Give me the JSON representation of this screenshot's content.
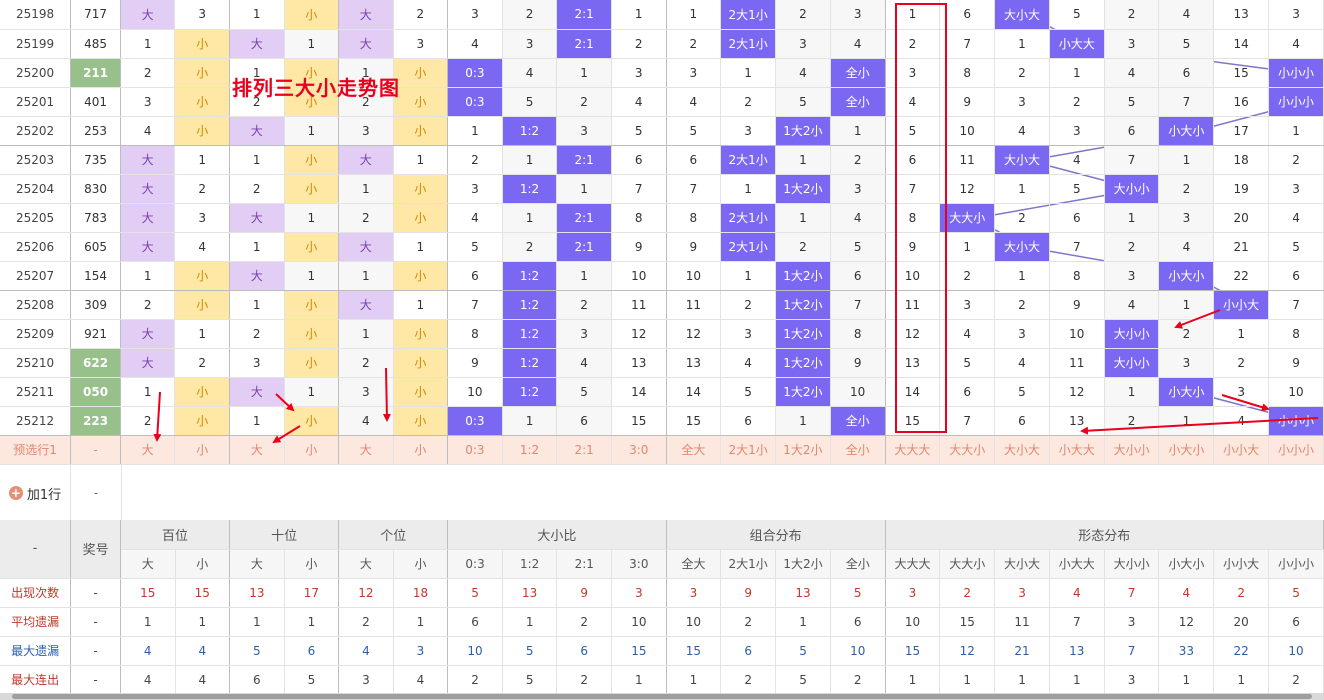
{
  "trend_rows": [
    {
      "issue": "25198",
      "award": "717",
      "hl": false,
      "bw": "大",
      "bx": "3",
      "sd": "1",
      "sx": "小",
      "gd": "大",
      "gx": "2",
      "r03": "3",
      "r12": "2",
      "r21": "2:1",
      "r30": "1",
      "qd": "1",
      "d2x1": "2大1小",
      "d1x2": "2",
      "qx": "3",
      "f1": "1",
      "f2": "6",
      "f3": "大小大",
      "f4": "5",
      "f5": "2",
      "f6": "4",
      "f7": "13",
      "f8": "3"
    },
    {
      "issue": "25199",
      "award": "485",
      "hl": false,
      "bw": "1",
      "bx": "小",
      "sd": "大",
      "sx": "1",
      "gd": "大",
      "gx": "3",
      "r03": "4",
      "r12": "3",
      "r21": "2:1",
      "r30": "2",
      "qd": "2",
      "d2x1": "2大1小",
      "d1x2": "3",
      "qx": "4",
      "f1": "2",
      "f2": "7",
      "f3": "1",
      "f4": "小大大",
      "f5": "3",
      "f6": "5",
      "f7": "14",
      "f8": "4"
    },
    {
      "issue": "25200",
      "award": "211",
      "hl": true,
      "bw": "2",
      "bx": "小",
      "sd": "1",
      "sx": "小",
      "gd": "1",
      "gx": "小",
      "r03": "0:3",
      "r12": "4",
      "r21": "1",
      "r30": "3",
      "qd": "3",
      "d2x1": "1",
      "d1x2": "4",
      "qx": "全小",
      "f1": "3",
      "f2": "8",
      "f3": "2",
      "f4": "1",
      "f5": "4",
      "f6": "6",
      "f7": "15",
      "f8": "小小小"
    },
    {
      "issue": "25201",
      "award": "401",
      "hl": false,
      "bw": "3",
      "bx": "小",
      "sd": "2",
      "sx": "小",
      "gd": "2",
      "gx": "小",
      "r03": "0:3",
      "r12": "5",
      "r21": "2",
      "r30": "4",
      "qd": "4",
      "d2x1": "2",
      "d1x2": "5",
      "qx": "全小",
      "f1": "4",
      "f2": "9",
      "f3": "3",
      "f4": "2",
      "f5": "5",
      "f6": "7",
      "f7": "16",
      "f8": "小小小"
    },
    {
      "issue": "25202",
      "award": "253",
      "hl": false,
      "bw": "4",
      "bx": "小",
      "sd": "大",
      "sx": "1",
      "gd": "3",
      "gx": "小",
      "r03": "1",
      "r12": "1:2",
      "r21": "3",
      "r30": "5",
      "qd": "5",
      "d2x1": "3",
      "d1x2": "1大2小",
      "qx": "1",
      "f1": "5",
      "f2": "10",
      "f3": "4",
      "f4": "3",
      "f5": "6",
      "f6": "小大小",
      "f7": "17",
      "f8": "1"
    },
    {
      "issue": "25203",
      "award": "735",
      "hl": false,
      "bw": "大",
      "bx": "1",
      "sd": "1",
      "sx": "小",
      "gd": "大",
      "gx": "1",
      "r03": "2",
      "r12": "1",
      "r21": "2:1",
      "r30": "6",
      "qd": "6",
      "d2x1": "2大1小",
      "d1x2": "1",
      "qx": "2",
      "f1": "6",
      "f2": "11",
      "f3": "大小大",
      "f4": "4",
      "f5": "7",
      "f6": "1",
      "f7": "18",
      "f8": "2"
    },
    {
      "issue": "25204",
      "award": "830",
      "hl": false,
      "bw": "大",
      "bx": "2",
      "sd": "2",
      "sx": "小",
      "gd": "1",
      "gx": "小",
      "r03": "3",
      "r12": "1:2",
      "r21": "1",
      "r30": "7",
      "qd": "7",
      "d2x1": "1",
      "d1x2": "1大2小",
      "qx": "3",
      "f1": "7",
      "f2": "12",
      "f3": "1",
      "f4": "5",
      "f5": "大小小",
      "f6": "2",
      "f7": "19",
      "f8": "3"
    },
    {
      "issue": "25205",
      "award": "783",
      "hl": false,
      "bw": "大",
      "bx": "3",
      "sd": "大",
      "sx": "1",
      "gd": "2",
      "gx": "小",
      "r03": "4",
      "r12": "1",
      "r21": "2:1",
      "r30": "8",
      "qd": "8",
      "d2x1": "2大1小",
      "d1x2": "1",
      "qx": "4",
      "f1": "8",
      "f2": "大大小",
      "f3": "2",
      "f4": "6",
      "f5": "1",
      "f6": "3",
      "f7": "20",
      "f8": "4"
    },
    {
      "issue": "25206",
      "award": "605",
      "hl": false,
      "bw": "大",
      "bx": "4",
      "sd": "1",
      "sx": "小",
      "gd": "大",
      "gx": "1",
      "r03": "5",
      "r12": "2",
      "r21": "2:1",
      "r30": "9",
      "qd": "9",
      "d2x1": "2大1小",
      "d1x2": "2",
      "qx": "5",
      "f1": "9",
      "f2": "1",
      "f3": "大小大",
      "f4": "7",
      "f5": "2",
      "f6": "4",
      "f7": "21",
      "f8": "5"
    },
    {
      "issue": "25207",
      "award": "154",
      "hl": false,
      "bw": "1",
      "bx": "小",
      "sd": "大",
      "sx": "1",
      "gd": "1",
      "gx": "小",
      "r03": "6",
      "r12": "1:2",
      "r21": "1",
      "r30": "10",
      "qd": "10",
      "d2x1": "1",
      "d1x2": "1大2小",
      "qx": "6",
      "f1": "10",
      "f2": "2",
      "f3": "1",
      "f4": "8",
      "f5": "3",
      "f6": "小大小",
      "f7": "22",
      "f8": "6"
    },
    {
      "issue": "25208",
      "award": "309",
      "hl": false,
      "bw": "2",
      "bx": "小",
      "sd": "1",
      "sx": "小",
      "gd": "大",
      "gx": "1",
      "r03": "7",
      "r12": "1:2",
      "r21": "2",
      "r30": "11",
      "qd": "11",
      "d2x1": "2",
      "d1x2": "1大2小",
      "qx": "7",
      "f1": "11",
      "f2": "3",
      "f3": "2",
      "f4": "9",
      "f5": "4",
      "f6": "1",
      "f7": "小小大",
      "f8": "7"
    },
    {
      "issue": "25209",
      "award": "921",
      "hl": false,
      "bw": "大",
      "bx": "1",
      "sd": "2",
      "sx": "小",
      "gd": "1",
      "gx": "小",
      "r03": "8",
      "r12": "1:2",
      "r21": "3",
      "r30": "12",
      "qd": "12",
      "d2x1": "3",
      "d1x2": "1大2小",
      "qx": "8",
      "f1": "12",
      "f2": "4",
      "f3": "3",
      "f4": "10",
      "f5": "大小小",
      "f6": "2",
      "f7": "1",
      "f8": "8"
    },
    {
      "issue": "25210",
      "award": "622",
      "hl": true,
      "bw": "大",
      "bx": "2",
      "sd": "3",
      "sx": "小",
      "gd": "2",
      "gx": "小",
      "r03": "9",
      "r12": "1:2",
      "r21": "4",
      "r30": "13",
      "qd": "13",
      "d2x1": "4",
      "d1x2": "1大2小",
      "qx": "9",
      "f1": "13",
      "f2": "5",
      "f3": "4",
      "f4": "11",
      "f5": "大小小",
      "f6": "3",
      "f7": "2",
      "f8": "9"
    },
    {
      "issue": "25211",
      "award": "050",
      "hl": true,
      "bw": "1",
      "bx": "小",
      "sd": "大",
      "sx": "1",
      "gd": "3",
      "gx": "小",
      "r03": "10",
      "r12": "1:2",
      "r21": "5",
      "r30": "14",
      "qd": "14",
      "d2x1": "5",
      "d1x2": "1大2小",
      "qx": "10",
      "f1": "14",
      "f2": "6",
      "f3": "5",
      "f4": "12",
      "f5": "1",
      "f6": "小大小",
      "f7": "3",
      "f8": "10"
    },
    {
      "issue": "25212",
      "award": "223",
      "hl": true,
      "bw": "2",
      "bx": "小",
      "sd": "1",
      "sx": "小",
      "gd": "4",
      "gx": "小",
      "r03": "0:3",
      "r12": "1",
      "r21": "6",
      "r30": "15",
      "qd": "15",
      "d2x1": "6",
      "d1x2": "1",
      "qx": "全小",
      "f1": "15",
      "f2": "7",
      "f3": "6",
      "f4": "13",
      "f5": "2",
      "f6": "1",
      "f7": "4",
      "f8": "小小小"
    }
  ],
  "preselect": {
    "label": "预选行1",
    "award": "-",
    "cells": [
      "大",
      "小",
      "大",
      "小",
      "大",
      "小",
      "0:3",
      "1:2",
      "2:1",
      "3:0",
      "全大",
      "2大1小",
      "1大2小",
      "全小",
      "大大大",
      "大大小",
      "大小大",
      "小大大",
      "大小小",
      "小大小",
      "小小大",
      "小小小"
    ]
  },
  "addrow": {
    "label": "加1行",
    "dash": "-"
  },
  "title_banner": "排列三大小走势图",
  "header": {
    "corner": "-",
    "award": "奖号",
    "groups": [
      "百位",
      "十位",
      "个位",
      "大小比",
      "组合分布",
      "形态分布"
    ],
    "sub": [
      "大",
      "小",
      "大",
      "小",
      "大",
      "小",
      "0:3",
      "1:2",
      "2:1",
      "3:0",
      "全大",
      "2大1小",
      "1大2小",
      "全小",
      "大大大",
      "大大小",
      "大小大",
      "小大大",
      "大小小",
      "小大小",
      "小小大",
      "小小小"
    ]
  },
  "stats": [
    {
      "label": "出现次数",
      "award": "-",
      "color": "red",
      "vals": [
        "15",
        "15",
        "13",
        "17",
        "12",
        "18",
        "5",
        "13",
        "9",
        "3",
        "3",
        "9",
        "13",
        "5",
        "3",
        "2",
        "3",
        "4",
        "7",
        "4",
        "2",
        "5"
      ]
    },
    {
      "label": "平均遗漏",
      "award": "-",
      "color": "dark",
      "vals": [
        "1",
        "1",
        "1",
        "1",
        "2",
        "1",
        "6",
        "1",
        "2",
        "10",
        "10",
        "2",
        "1",
        "6",
        "10",
        "15",
        "11",
        "7",
        "3",
        "12",
        "20",
        "6"
      ]
    },
    {
      "label": "最大遗漏",
      "award": "-",
      "color": "blue",
      "vals": [
        "4",
        "4",
        "5",
        "6",
        "4",
        "3",
        "10",
        "5",
        "6",
        "15",
        "15",
        "6",
        "5",
        "10",
        "15",
        "12",
        "21",
        "13",
        "7",
        "33",
        "22",
        "10"
      ]
    },
    {
      "label": "最大连出",
      "award": "-",
      "color": "dark",
      "vals": [
        "4",
        "4",
        "6",
        "5",
        "3",
        "4",
        "2",
        "5",
        "2",
        "1",
        "1",
        "2",
        "5",
        "2",
        "1",
        "1",
        "1",
        "1",
        "3",
        "1",
        "1",
        "2"
      ]
    }
  ]
}
